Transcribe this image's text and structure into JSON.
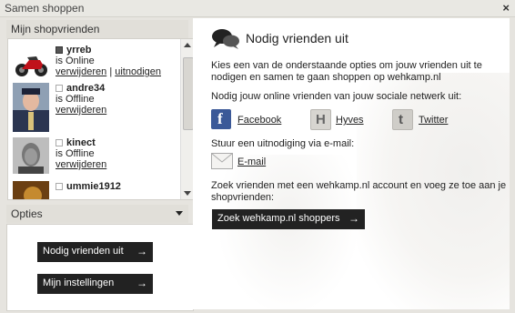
{
  "window": {
    "title": "Samen shoppen",
    "close": "×"
  },
  "friends_panel": {
    "title": "Mijn shopvrienden",
    "friends": [
      {
        "name": "yrreb",
        "status": "is Online",
        "online": true,
        "links": [
          "verwijderen",
          "uitnodigen"
        ],
        "separator": "|"
      },
      {
        "name": "andre34",
        "status": "is Offline",
        "online": false,
        "links": [
          "verwijderen"
        ]
      },
      {
        "name": "kinect",
        "status": "is Offline",
        "online": false,
        "links": [
          "verwijderen"
        ]
      },
      {
        "name": "ummie1912",
        "status": "",
        "online": false,
        "links": []
      }
    ]
  },
  "options_panel": {
    "title": "Opties",
    "buttons": [
      {
        "label": "Nodig vrienden uit",
        "arrow": "→"
      },
      {
        "label": "Mijn instellingen",
        "arrow": "→"
      }
    ]
  },
  "main": {
    "heading": "Nodig vrienden uit",
    "intro_line1": "Kies een van de onderstaande opties om jouw vrienden uit te",
    "intro_line2": "nodigen en samen te gaan shoppen op wehkamp.nl",
    "social_intro": "Nodig jouw online vrienden van jouw sociale netwerk uit:",
    "social": {
      "facebook": "Facebook",
      "hyves": "Hyves",
      "twitter": "Twitter"
    },
    "email_intro": "Stuur een uitnodiging via e-mail:",
    "email_label": "E-mail",
    "search_line1": "Zoek vrienden met een wehkamp.nl account en voeg ze toe aan je",
    "search_line2": "shopvrienden:",
    "search_button": "Zoek wehkamp.nl shoppers",
    "search_arrow": "→"
  },
  "colors": {
    "button_bg": "#222222",
    "facebook": "#3b5998",
    "panel_bg": "#e1dfd9"
  }
}
